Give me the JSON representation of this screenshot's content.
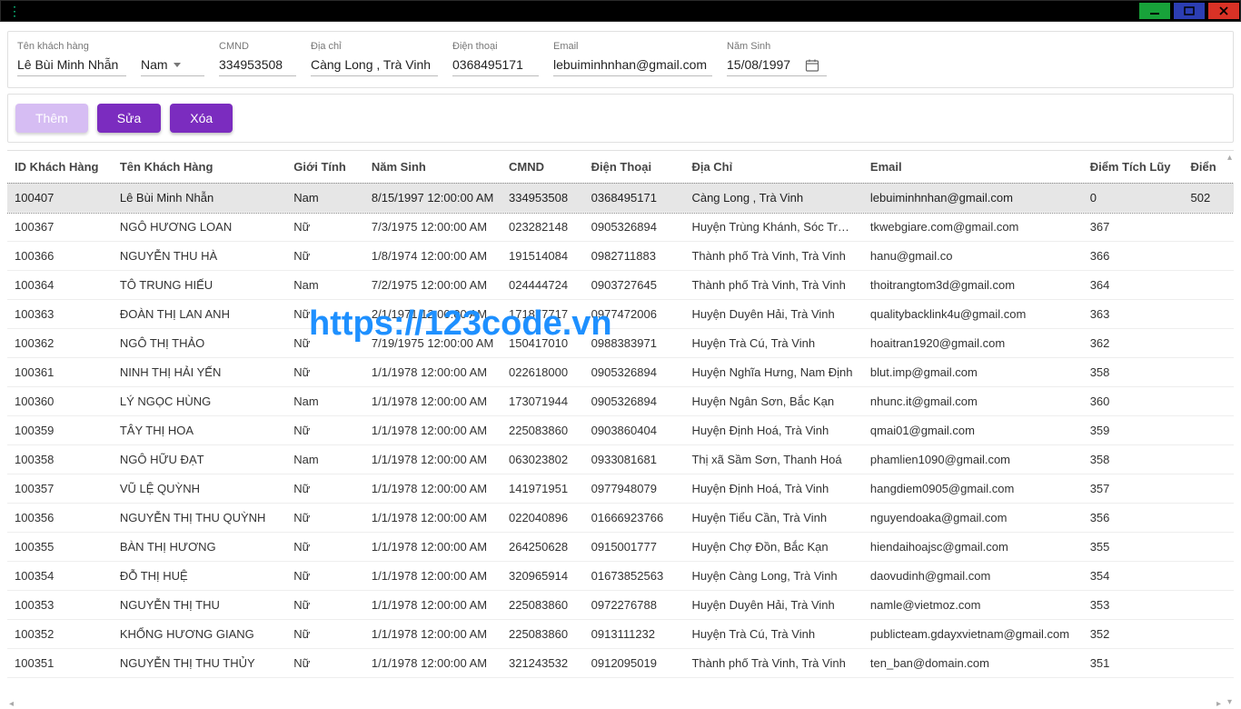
{
  "window": {
    "menu_glyph": "⋮"
  },
  "form": {
    "customer_name_label": "Tên khách hàng",
    "customer_name_value": "Lê Bùi Minh Nhẫn",
    "gender_value": "Nam",
    "cmnd_label": "CMND",
    "cmnd_value": "334953508",
    "address_label": "Địa chỉ",
    "address_value": "Càng Long , Trà Vinh",
    "phone_label": "Điện thoại",
    "phone_value": "0368495171",
    "email_label": "Email",
    "email_value": "lebuiminhnhan@gmail.com",
    "birth_label": "Năm Sinh",
    "birth_value": "15/08/1997"
  },
  "actions": {
    "add": "Thêm",
    "edit": "Sửa",
    "delete": "Xóa"
  },
  "table": {
    "headers": {
      "id": "ID Khách Hàng",
      "name": "Tên Khách Hàng",
      "gender": "Giới Tính",
      "birth": "Năm Sinh",
      "cmnd": "CMND",
      "phone": "Điện Thoại",
      "address": "Địa Chỉ",
      "email": "Email",
      "points": "Điểm Tích Lũy",
      "extra": "Điển"
    },
    "rows": [
      {
        "id": "100407",
        "name": "Lê Bùi Minh Nhẫn",
        "gender": "Nam",
        "birth": "8/15/1997 12:00:00 AM",
        "cmnd": "334953508",
        "phone": "0368495171",
        "address": "Càng Long , Trà Vinh",
        "email": "lebuiminhnhan@gmail.com",
        "points": "0",
        "extra": "502"
      },
      {
        "id": "100367",
        "name": "NGÔ HƯƠNG LOAN",
        "gender": "Nữ",
        "birth": "7/3/1975 12:00:00 AM",
        "cmnd": "023282148",
        "phone": "0905326894",
        "address": "Huyện Trùng Khánh, Sóc Trăng",
        "email": "tkwebgiare.com@gmail.com",
        "points": "367",
        "extra": ""
      },
      {
        "id": "100366",
        "name": "NGUYỄN THU HÀ",
        "gender": "Nữ",
        "birth": "1/8/1974 12:00:00 AM",
        "cmnd": "191514084",
        "phone": "0982711883",
        "address": "Thành phố Trà Vinh, Trà Vinh",
        "email": "hanu@gmail.co",
        "points": "366",
        "extra": ""
      },
      {
        "id": "100364",
        "name": "TÔ TRUNG HIẾU",
        "gender": "Nam",
        "birth": "7/2/1975 12:00:00 AM",
        "cmnd": "024444724",
        "phone": "0903727645",
        "address": "Thành phố Trà Vinh, Trà Vinh",
        "email": "thoitrangtom3d@gmail.com",
        "points": "364",
        "extra": ""
      },
      {
        "id": "100363",
        "name": "ĐOÀN THỊ LAN ANH",
        "gender": "Nữ",
        "birth": "2/1/1971 12:00:00 AM",
        "cmnd": "171877717",
        "phone": "0977472006",
        "address": "Huyện Duyên Hải, Trà Vinh",
        "email": "qualitybacklink4u@gmail.com",
        "points": "363",
        "extra": ""
      },
      {
        "id": "100362",
        "name": "NGÔ THỊ THẢO",
        "gender": "Nữ",
        "birth": "7/19/1975 12:00:00 AM",
        "cmnd": "150417010",
        "phone": "0988383971",
        "address": "Huyện Trà Cú, Trà Vinh",
        "email": "hoaitran1920@gmail.com",
        "points": "362",
        "extra": ""
      },
      {
        "id": "100361",
        "name": "NINH THỊ HẢI YẾN",
        "gender": "Nữ",
        "birth": "1/1/1978 12:00:00 AM",
        "cmnd": "022618000",
        "phone": "0905326894",
        "address": "Huyện Nghĩa Hưng, Nam Định",
        "email": "blut.imp@gmail.com",
        "points": "358",
        "extra": ""
      },
      {
        "id": "100360",
        "name": "LÝ NGỌC HÙNG",
        "gender": "Nam",
        "birth": "1/1/1978 12:00:00 AM",
        "cmnd": "173071944",
        "phone": "0905326894",
        "address": "Huyện Ngân Sơn, Bắc Kạn",
        "email": "nhunc.it@gmail.com",
        "points": "360",
        "extra": ""
      },
      {
        "id": "100359",
        "name": "TÂY THỊ HOA",
        "gender": "Nữ",
        "birth": "1/1/1978 12:00:00 AM",
        "cmnd": "225083860",
        "phone": "0903860404",
        "address": "Huyện Định Hoá, Trà Vinh",
        "email": "qmai01@gmail.com",
        "points": "359",
        "extra": ""
      },
      {
        "id": "100358",
        "name": "NGÔ HỮU ĐẠT",
        "gender": "Nam",
        "birth": "1/1/1978 12:00:00 AM",
        "cmnd": "063023802",
        "phone": "0933081681",
        "address": "Thị xã Sầm Sơn, Thanh Hoá",
        "email": "phamlien1090@gmail.com",
        "points": "358",
        "extra": ""
      },
      {
        "id": "100357",
        "name": "VŨ LỆ QUỲNH",
        "gender": "Nữ",
        "birth": "1/1/1978 12:00:00 AM",
        "cmnd": "141971951",
        "phone": "0977948079",
        "address": "Huyện Định Hoá, Trà Vinh",
        "email": "hangdiem0905@gmail.com",
        "points": "357",
        "extra": ""
      },
      {
        "id": "100356",
        "name": "NGUYỄN THỊ THU QUỲNH",
        "gender": "Nữ",
        "birth": "1/1/1978 12:00:00 AM",
        "cmnd": "022040896",
        "phone": "01666923766",
        "address": "Huyện Tiểu Cần, Trà Vinh",
        "email": "nguyendoaka@gmail.com",
        "points": "356",
        "extra": ""
      },
      {
        "id": "100355",
        "name": "BÀN THỊ HƯƠNG",
        "gender": "Nữ",
        "birth": "1/1/1978 12:00:00 AM",
        "cmnd": "264250628",
        "phone": "0915001777",
        "address": "Huyện Chợ Đồn, Bắc Kạn",
        "email": "hiendaihoajsc@gmail.com",
        "points": "355",
        "extra": ""
      },
      {
        "id": "100354",
        "name": "ĐỖ THỊ HUỆ",
        "gender": "Nữ",
        "birth": "1/1/1978 12:00:00 AM",
        "cmnd": "320965914",
        "phone": "01673852563",
        "address": "Huyện Càng Long, Trà Vinh",
        "email": "daovudinh@gmail.com",
        "points": "354",
        "extra": ""
      },
      {
        "id": "100353",
        "name": "NGUYỄN THỊ THU",
        "gender": "Nữ",
        "birth": "1/1/1978 12:00:00 AM",
        "cmnd": "225083860",
        "phone": "0972276788",
        "address": "Huyện Duyên Hải, Trà Vinh",
        "email": "namle@vietmoz.com",
        "points": "353",
        "extra": ""
      },
      {
        "id": "100352",
        "name": "KHỔNG HƯƠNG GIANG",
        "gender": "Nữ",
        "birth": "1/1/1978 12:00:00 AM",
        "cmnd": "225083860",
        "phone": "0913111232",
        "address": "Huyện Trà Cú, Trà Vinh",
        "email": "publicteam.gdayxvietnam@gmail.com",
        "points": "352",
        "extra": ""
      },
      {
        "id": "100351",
        "name": "NGUYỄN THỊ THU THỦY",
        "gender": "Nữ",
        "birth": "1/1/1978 12:00:00 AM",
        "cmnd": "321243532",
        "phone": "0912095019",
        "address": "Thành phố Trà Vinh, Trà Vinh",
        "email": "ten_ban@domain.com",
        "points": "351",
        "extra": ""
      }
    ]
  },
  "watermark": "https://123code.vn"
}
